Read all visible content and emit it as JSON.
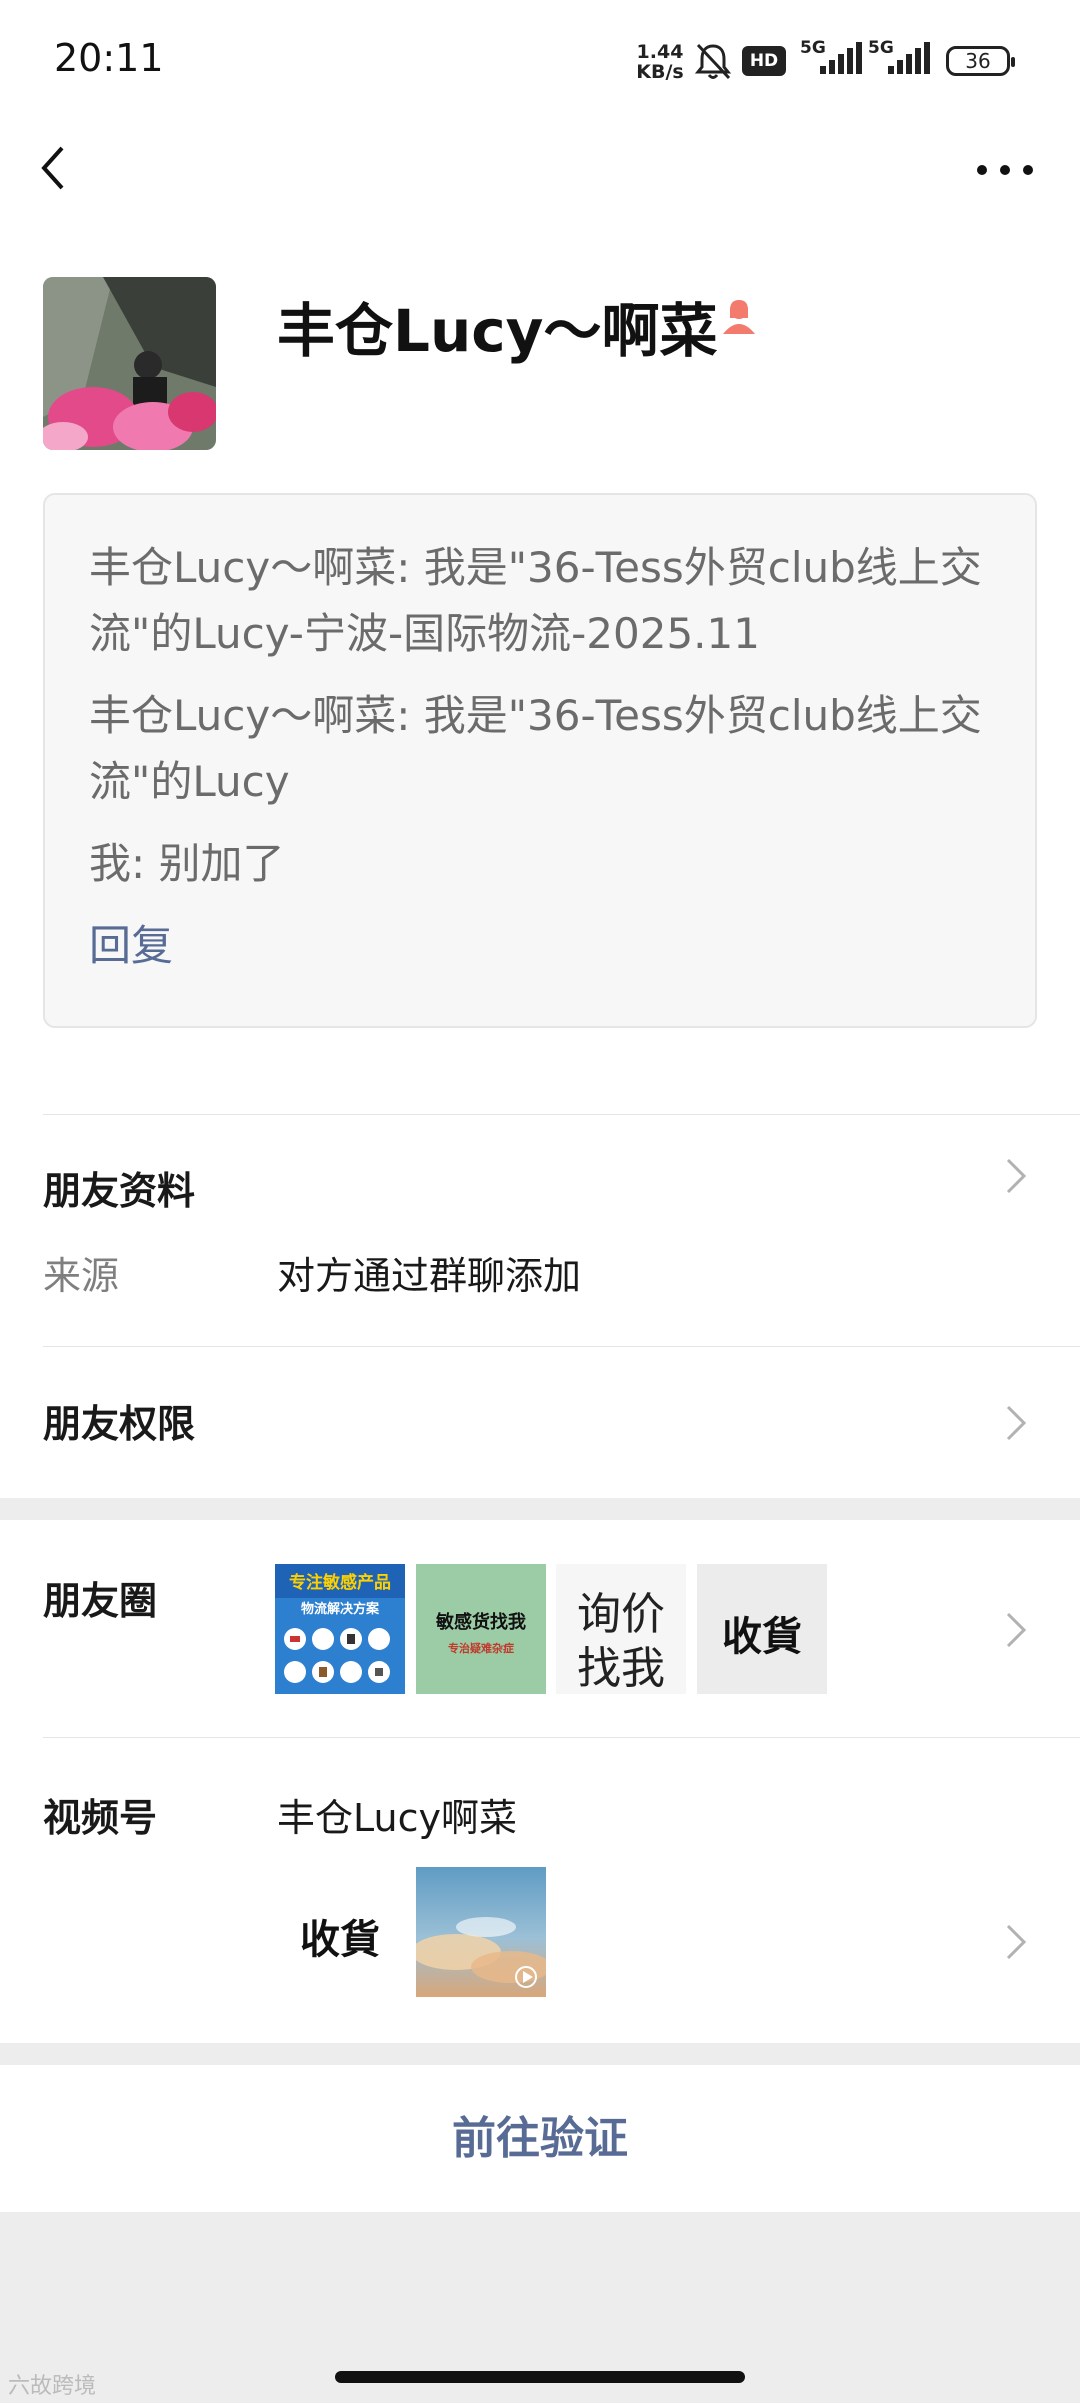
{
  "status_bar": {
    "time": "20:11",
    "net_speed_value": "1.44",
    "net_speed_unit": "KB/s",
    "hd_label": "HD",
    "signal1_label": "5G",
    "signal2_label": "5G",
    "battery": "36"
  },
  "header": {
    "back_icon": "chevron-left-icon",
    "more_icon": "more-dots-icon"
  },
  "profile": {
    "name": "丰仓Lucy～啊菜",
    "gender_icon": "female-person-icon"
  },
  "messages": [
    {
      "text": "丰仓Lucy～啊菜: 我是\"36-Tess外贸club线上交流\"的Lucy-宁波-国际物流-2025.11"
    },
    {
      "text": "丰仓Lucy～啊菜: 我是\"36-Tess外贸club线上交流\"的Lucy"
    },
    {
      "text": "我: 别加了"
    }
  ],
  "reply_label": "回复",
  "friend_info": {
    "title": "朋友资料",
    "source_label": "来源",
    "source_value": "对方通过群聊添加"
  },
  "permissions": {
    "title": "朋友权限"
  },
  "moments": {
    "title": "朋友圈",
    "thumb1_title": "专注敏感产品",
    "thumb1_sub": "物流解决方案",
    "thumb2_title": "敏感货找我",
    "thumb2_sub": "专治疑难杂症",
    "thumb3_line1": "询价",
    "thumb3_line2": "找我",
    "thumb4_text": "收貨"
  },
  "channels": {
    "title": "视频号",
    "name": "丰仓Lucy啊菜",
    "thumb1_text": "收貨"
  },
  "verify_button": "前往验证",
  "watermark": "六故跨境",
  "colors": {
    "link": "#576b95",
    "background": "#ededed",
    "card": "#ffffff"
  }
}
